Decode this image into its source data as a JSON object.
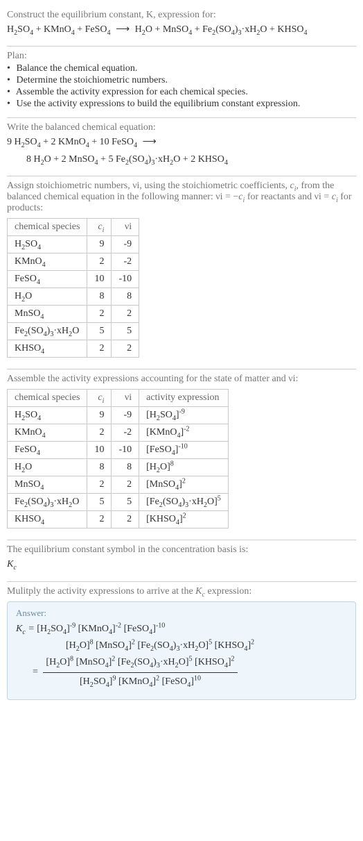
{
  "intro": {
    "construct_label": "Construct the equilibrium constant, K, expression for:",
    "main_equation": "H2SO4 + KMnO4 + FeSO4 ⟶ H2O + MnSO4 + Fe2(SO4)3·xH2O + KHSO4"
  },
  "plan": {
    "title": "Plan:",
    "items": [
      "Balance the chemical equation.",
      "Determine the stoichiometric numbers.",
      "Assemble the activity expression for each chemical species.",
      "Use the activity expressions to build the equilibrium constant expression."
    ]
  },
  "balanced": {
    "title": "Write the balanced chemical equation:",
    "line1": "9 H2SO4 + 2 KMnO4 + 10 FeSO4 ⟶",
    "line2": "8 H2O + 2 MnSO4 + 5 Fe2(SO4)3·xH2O + 2 KHSO4"
  },
  "stoich": {
    "title": "Assign stoichiometric numbers, νi, using the stoichiometric coefficients, ci, from the balanced chemical equation in the following manner: νi = −ci for reactants and νi = ci for products:",
    "headers": {
      "species": "chemical species",
      "c": "ci",
      "v": "νi"
    },
    "rows": [
      {
        "species": "H2SO4",
        "c": "9",
        "v": "-9"
      },
      {
        "species": "KMnO4",
        "c": "2",
        "v": "-2"
      },
      {
        "species": "FeSO4",
        "c": "10",
        "v": "-10"
      },
      {
        "species": "H2O",
        "c": "8",
        "v": "8"
      },
      {
        "species": "MnSO4",
        "c": "2",
        "v": "2"
      },
      {
        "species": "Fe2(SO4)3·xH2O",
        "c": "5",
        "v": "5"
      },
      {
        "species": "KHSO4",
        "c": "2",
        "v": "2"
      }
    ]
  },
  "activity": {
    "title": "Assemble the activity expressions accounting for the state of matter and νi:",
    "headers": {
      "species": "chemical species",
      "c": "ci",
      "v": "νi",
      "expr": "activity expression"
    },
    "rows": [
      {
        "species": "H2SO4",
        "c": "9",
        "v": "-9",
        "base": "[H2SO4]",
        "exp": "-9"
      },
      {
        "species": "KMnO4",
        "c": "2",
        "v": "-2",
        "base": "[KMnO4]",
        "exp": "-2"
      },
      {
        "species": "FeSO4",
        "c": "10",
        "v": "-10",
        "base": "[FeSO4]",
        "exp": "-10"
      },
      {
        "species": "H2O",
        "c": "8",
        "v": "8",
        "base": "[H2O]",
        "exp": "8"
      },
      {
        "species": "MnSO4",
        "c": "2",
        "v": "2",
        "base": "[MnSO4]",
        "exp": "2"
      },
      {
        "species": "Fe2(SO4)3·xH2O",
        "c": "5",
        "v": "5",
        "base": "[Fe2(SO4)3·xH2O]",
        "exp": "5"
      },
      {
        "species": "KHSO4",
        "c": "2",
        "v": "2",
        "base": "[KHSO4]",
        "exp": "2"
      }
    ]
  },
  "kc_symbol": {
    "title": "The equilibrium constant symbol in the concentration basis is:",
    "value": "Kc"
  },
  "multiply": {
    "title": "Mulitply the activity expressions to arrive at the Kc expression:"
  },
  "answer": {
    "label": "Answer:",
    "line1_prefix": "Kc = ",
    "line1_factors": [
      {
        "base": "[H2SO4]",
        "exp": "-9"
      },
      {
        "base": "[KMnO4]",
        "exp": "-2"
      },
      {
        "base": "[FeSO4]",
        "exp": "-10"
      }
    ],
    "line2_factors": [
      {
        "base": "[H2O]",
        "exp": "8"
      },
      {
        "base": "[MnSO4]",
        "exp": "2"
      },
      {
        "base": "[Fe2(SO4)3·xH2O]",
        "exp": "5"
      },
      {
        "base": "[KHSO4]",
        "exp": "2"
      }
    ],
    "equals": "= ",
    "fraction_num": [
      {
        "base": "[H2O]",
        "exp": "8"
      },
      {
        "base": "[MnSO4]",
        "exp": "2"
      },
      {
        "base": "[Fe2(SO4)3·xH2O]",
        "exp": "5"
      },
      {
        "base": "[KHSO4]",
        "exp": "2"
      }
    ],
    "fraction_den": [
      {
        "base": "[H2SO4]",
        "exp": "9"
      },
      {
        "base": "[KMnO4]",
        "exp": "2"
      },
      {
        "base": "[FeSO4]",
        "exp": "10"
      }
    ]
  },
  "chart_data": {
    "type": "table",
    "tables": [
      {
        "name": "stoichiometric_numbers",
        "columns": [
          "chemical species",
          "ci",
          "νi"
        ],
        "rows": [
          [
            "H2SO4",
            9,
            -9
          ],
          [
            "KMnO4",
            2,
            -2
          ],
          [
            "FeSO4",
            10,
            -10
          ],
          [
            "H2O",
            8,
            8
          ],
          [
            "MnSO4",
            2,
            2
          ],
          [
            "Fe2(SO4)3·xH2O",
            5,
            5
          ],
          [
            "KHSO4",
            2,
            2
          ]
        ]
      },
      {
        "name": "activity_expressions",
        "columns": [
          "chemical species",
          "ci",
          "νi",
          "activity expression"
        ],
        "rows": [
          [
            "H2SO4",
            9,
            -9,
            "[H2SO4]^-9"
          ],
          [
            "KMnO4",
            2,
            -2,
            "[KMnO4]^-2"
          ],
          [
            "FeSO4",
            10,
            -10,
            "[FeSO4]^-10"
          ],
          [
            "H2O",
            8,
            8,
            "[H2O]^8"
          ],
          [
            "MnSO4",
            2,
            2,
            "[MnSO4]^2"
          ],
          [
            "Fe2(SO4)3·xH2O",
            5,
            5,
            "[Fe2(SO4)3·xH2O]^5"
          ],
          [
            "KHSO4",
            2,
            2,
            "[KHSO4]^2"
          ]
        ]
      }
    ]
  }
}
